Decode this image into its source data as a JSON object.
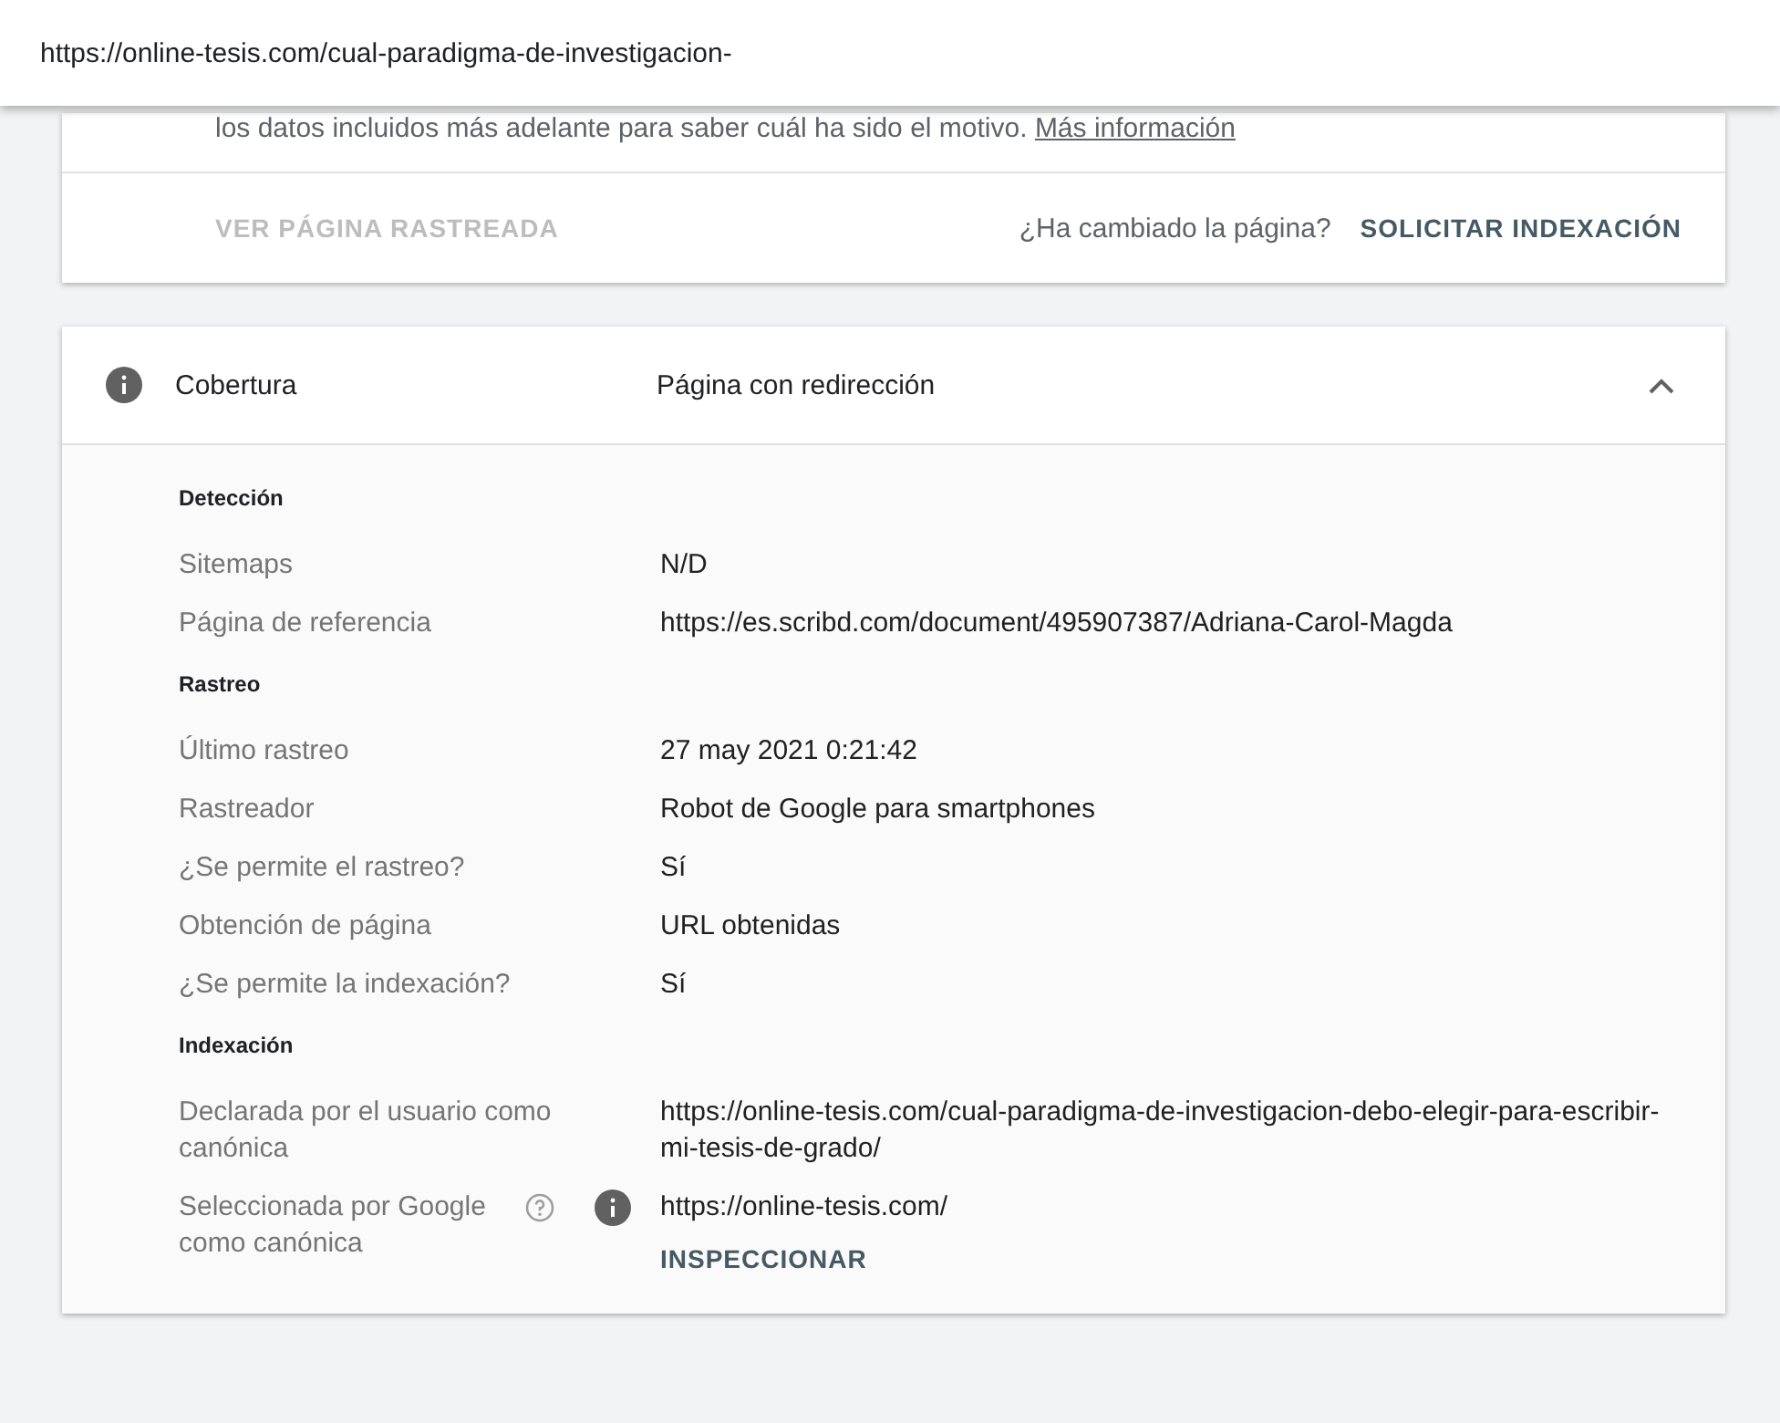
{
  "url_bar": {
    "url": "https://online-tesis.com/cual-paradigma-de-investigacion-"
  },
  "status_card": {
    "text": "los datos incluidos más adelante para saber cuál ha sido el motivo.",
    "link": "Más información",
    "view_button": {
      "label": "VER PÁGINA RASTREADA",
      "disabled": true
    },
    "question": "¿Ha cambiado la página?",
    "request_button": "SOLICITAR INDEXACIÓN"
  },
  "coverage": {
    "title": "Cobertura",
    "status": "Página con redirección",
    "expanded": true,
    "sections": [
      {
        "heading": "Detección",
        "rows": [
          {
            "kind": "plain",
            "label": "Sitemaps",
            "value": "N/D"
          },
          {
            "kind": "plain",
            "label": "Página de referencia",
            "value": "https://es.scribd.com/document/495907387/Adriana-Carol-Magda"
          }
        ]
      },
      {
        "heading": "Rastreo",
        "rows": [
          {
            "kind": "plain",
            "label": "Último rastreo",
            "value": "27 may 2021 0:21:42"
          },
          {
            "kind": "plain",
            "label": "Rastreador",
            "value": "Robot de Google para smartphones"
          },
          {
            "kind": "plain",
            "label": "¿Se permite el rastreo?",
            "value": "Sí"
          },
          {
            "kind": "plain",
            "label": "Obtención de página",
            "value": "URL obtenidas"
          },
          {
            "kind": "plain",
            "label": "¿Se permite la indexación?",
            "value": "Sí"
          }
        ]
      },
      {
        "heading": "Indexación",
        "rows": [
          {
            "kind": "plain",
            "label": "Declarada por el usuario como canónica",
            "value": "https://online-tesis.com/cual-paradigma-de-investigacion-debo-elegir-para-escribir-mi-tesis-de-grado/"
          },
          {
            "kind": "with-icons",
            "label": "Seleccionada por Google como canónica",
            "value": "https://online-tesis.com/",
            "action": "INSPECCIONAR"
          }
        ]
      }
    ]
  }
}
